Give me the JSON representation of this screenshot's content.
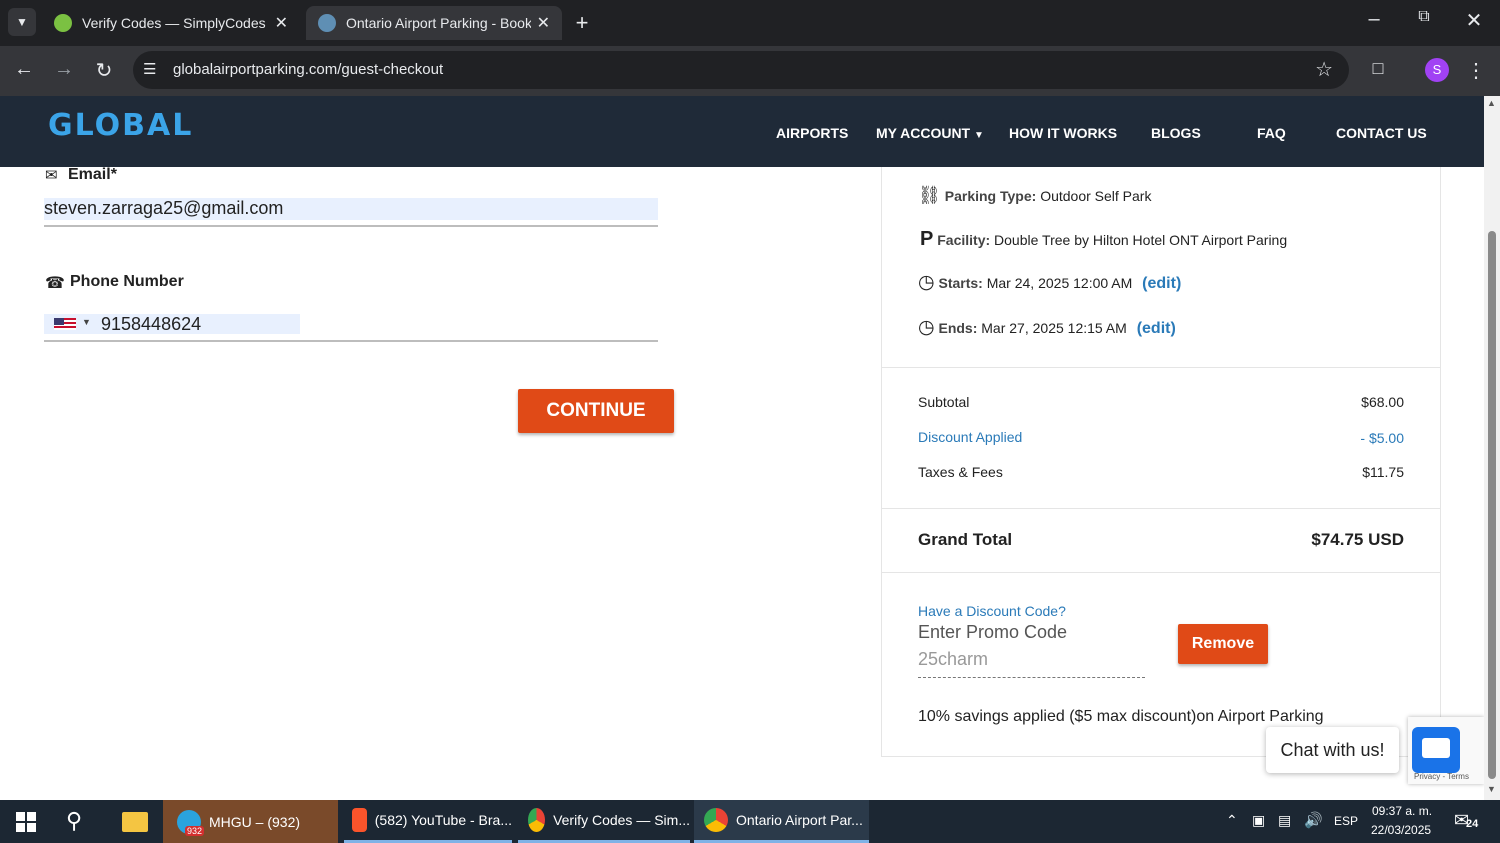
{
  "browser": {
    "tabs": [
      {
        "title": "Verify Codes — SimplyCodes"
      },
      {
        "title": "Ontario Airport Parking - Book"
      }
    ],
    "url": "globalairportparking.com/guest-checkout",
    "profile_initial": "S"
  },
  "site": {
    "logo": "GLOBAL",
    "nav": [
      "AIRPORTS",
      "MY ACCOUNT",
      "HOW IT WORKS",
      "BLOGS",
      "FAQ",
      "CONTACT US"
    ]
  },
  "form": {
    "email_label": "Email*",
    "email_value": "steven.zarraga25@gmail.com",
    "phone_label": "Phone Number",
    "phone_value": "9158448624",
    "continue_label": "CONTINUE"
  },
  "summary": {
    "parking_type_label": "Parking Type:",
    "parking_type_value": "Outdoor Self Park",
    "facility_label": "Facility:",
    "facility_value": "Double Tree by Hilton Hotel ONT Airport Paring",
    "starts_label": "Starts:",
    "starts_value": "Mar 24, 2025 12:00 AM",
    "ends_label": "Ends:",
    "ends_value": "Mar 27, 2025 12:15 AM",
    "edit_label": "(edit)",
    "subtotal_label": "Subtotal",
    "subtotal_value": "$68.00",
    "discount_label": "Discount Applied",
    "discount_value": "- $5.00",
    "taxes_label": "Taxes & Fees",
    "taxes_value": "$11.75",
    "grand_total_label": "Grand Total",
    "grand_total_value": "$74.75 USD",
    "discount_question": "Have a Discount Code?",
    "promo_placeholder": "Enter Promo Code",
    "promo_value": "25charm",
    "remove_label": "Remove",
    "savings_note": "10% savings applied ($5 max discount)on Airport Parking"
  },
  "chat": {
    "label": "Chat with us!",
    "recaptcha_text": "Privacy - Terms"
  },
  "taskbar": {
    "apps": [
      {
        "label": "MHGU – (932)",
        "badge": "932"
      },
      {
        "label": "(582) YouTube - Bra..."
      },
      {
        "label": "Verify Codes — Sim..."
      },
      {
        "label": "Ontario Airport Par..."
      }
    ],
    "language": "ESP",
    "time": "09:37 a. m.",
    "date": "22/03/2025",
    "notification_count": "24"
  }
}
